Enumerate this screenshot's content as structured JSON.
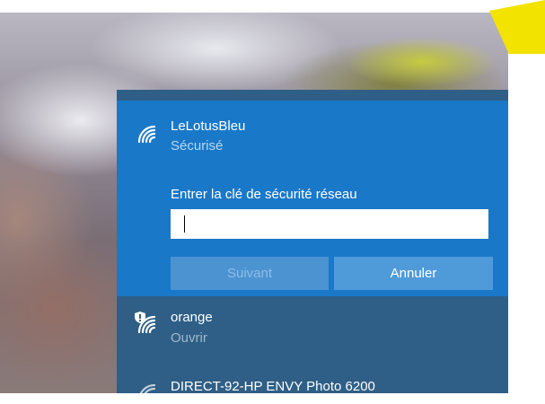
{
  "selected_network": {
    "name": "LeLotusBleu",
    "status": "Sécurisé",
    "key_label": "Entrer la clé de sécurité réseau",
    "key_value": "",
    "next_label": "Suivant",
    "cancel_label": "Annuler",
    "icon": "wifi-icon"
  },
  "networks": [
    {
      "name": "orange",
      "status": "Ouvrir",
      "icon": "wifi-open-shield-icon"
    },
    {
      "name": "DIRECT-92-HP ENVY Photo 6200",
      "icon": "wifi-icon"
    }
  ],
  "colors": {
    "selected_bg": "#1a78c8",
    "panel_bg": "#2f5f86",
    "accent_yellow": "#f3e300"
  }
}
